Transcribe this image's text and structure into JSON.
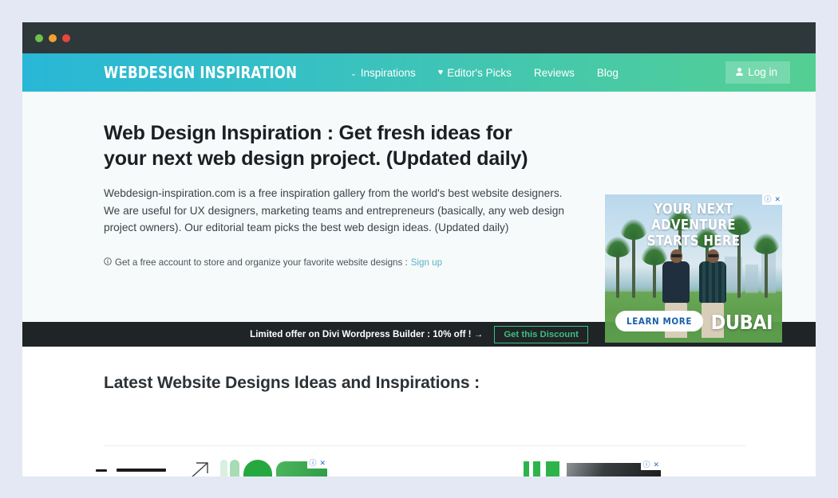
{
  "window": {
    "traffic_lights": [
      "green",
      "orange",
      "red"
    ]
  },
  "header": {
    "logo": "WEBDESIGN INSPIRATION",
    "nav": [
      {
        "label": "Inspirations",
        "icon": "chevron-down-icon",
        "glyph": "⌄"
      },
      {
        "label": "Editor's Picks",
        "icon": "heart-icon",
        "glyph": "♥"
      },
      {
        "label": "Reviews",
        "icon": null,
        "glyph": ""
      },
      {
        "label": "Blog",
        "icon": null,
        "glyph": ""
      }
    ],
    "login": {
      "label": "Log in",
      "icon": "user-icon",
      "glyph": "👤"
    },
    "gradient_from": "#28b7d6",
    "gradient_to": "#54cf93"
  },
  "hero": {
    "title": "Web Design Inspiration : Get fresh ideas for your next web design project. (Updated daily)",
    "paragraph": "Webdesign-inspiration.com is a free inspiration gallery from the world's best website designers. We are useful for UX designers, marketing teams and entrepreneurs (basically, any web design project owners). Our editorial team picks the best web design ideas. (Updated daily)",
    "note_icon": "info-circle-icon",
    "note_glyph": "⊙",
    "note_text": "Get a free account to store and organize your favorite website designs :",
    "note_link": "Sign up",
    "link_color": "#5ab4c4"
  },
  "ad": {
    "headline_line1": "YOUR NEXT ADVENTURE",
    "headline_line2": "STARTS HERE",
    "cta": "LEARN MORE",
    "brand": "DUBAI",
    "adchoices_info_glyph": "ⓘ",
    "adchoices_close_glyph": "✕"
  },
  "promo": {
    "text": "Limited offer on Divi Wordpress Builder : 10% off ! →",
    "button": "Get this Discount",
    "accent": "#3fbf7f"
  },
  "latest": {
    "title": "Latest Website Designs Ideas and Inspirations :"
  },
  "bottom_ad": {
    "adchoices_info_glyph": "ⓘ",
    "adchoices_close_glyph": "✕"
  }
}
